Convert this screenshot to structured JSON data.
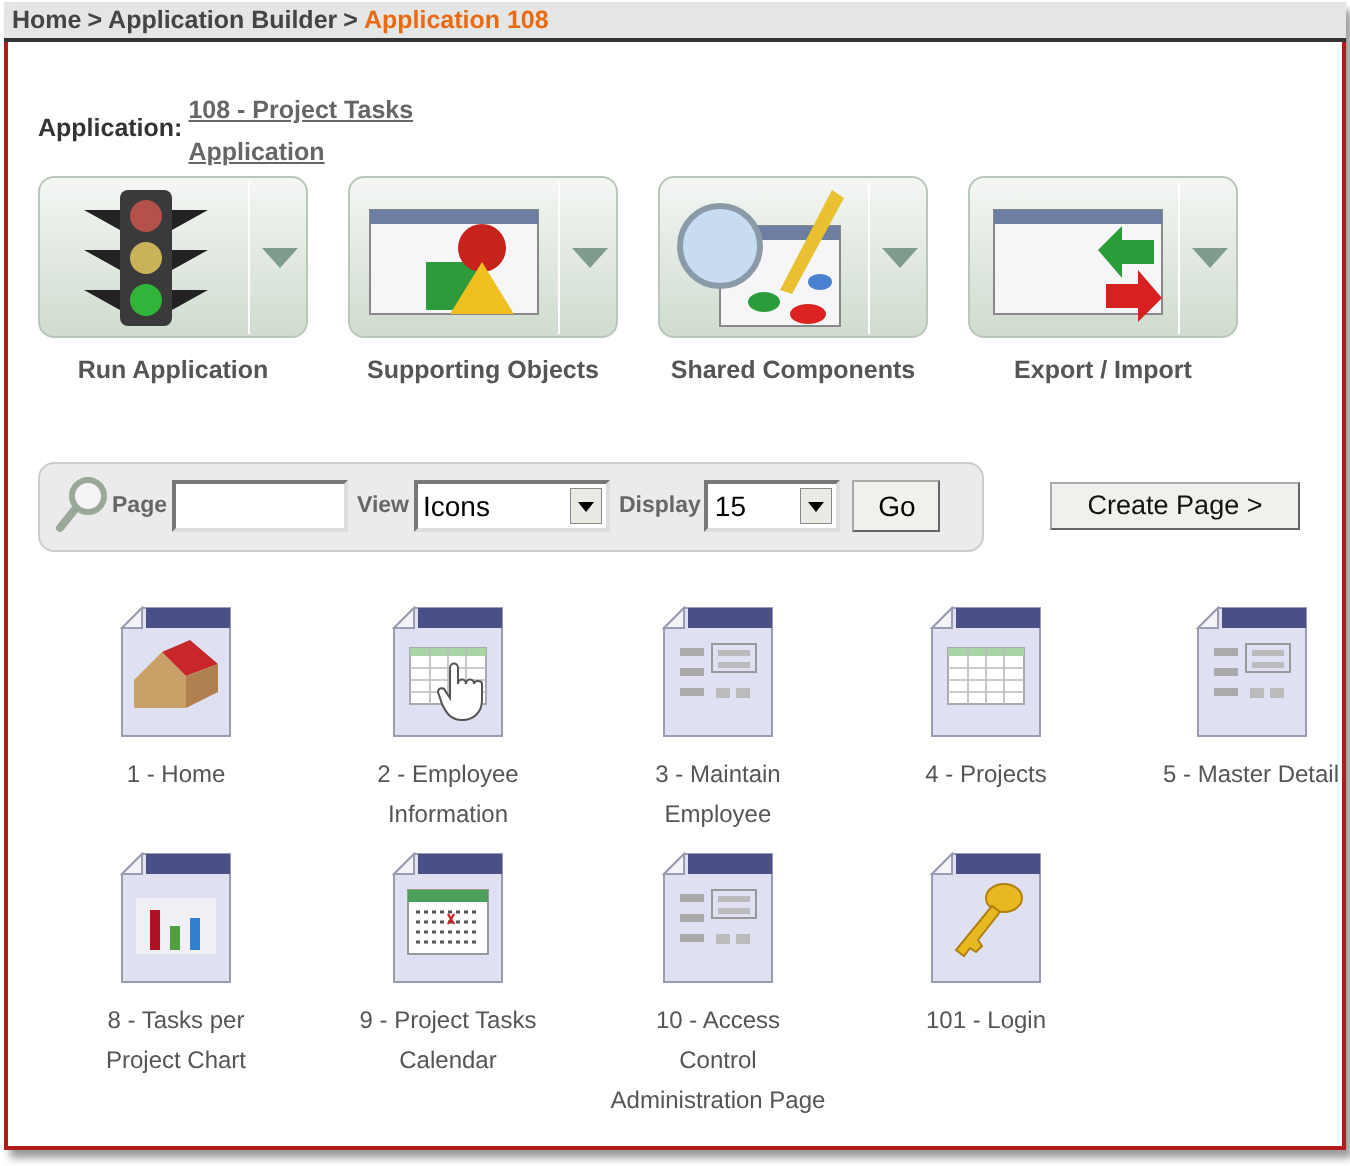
{
  "breadcrumb": [
    {
      "label": "Home",
      "current": false
    },
    {
      "label": "Application Builder",
      "current": false
    },
    {
      "label": "Application 108",
      "current": true
    }
  ],
  "breadcrumb_separator": ">",
  "application": {
    "label": "Application:",
    "link_lines": [
      "108 - Project Tasks",
      "Application"
    ]
  },
  "big_buttons": [
    {
      "label": "Run Application",
      "kind": "traffic"
    },
    {
      "label": "Supporting Objects",
      "kind": "shapes"
    },
    {
      "label": "Shared Components",
      "kind": "compass"
    },
    {
      "label": "Export / Import",
      "kind": "arrows"
    }
  ],
  "search_bar": {
    "page_label": "Page",
    "view_label": "View",
    "view_value": "Icons",
    "display_label": "Display",
    "display_value": "15",
    "go": "Go"
  },
  "create_button": "Create Page >",
  "pages": [
    {
      "lines": [
        "1 - Home"
      ],
      "kind": "home"
    },
    {
      "lines": [
        "2 - Employee",
        "Information"
      ],
      "kind": "grid-hand"
    },
    {
      "lines": [
        "3 - Maintain",
        "Employee"
      ],
      "kind": "form"
    },
    {
      "lines": [
        "4 - Projects"
      ],
      "kind": "grid"
    },
    {
      "lines": [
        "5 - Master Detail"
      ],
      "kind": "form"
    },
    {
      "lines": [
        "8 - Tasks per",
        "Project Chart"
      ],
      "kind": "chart"
    },
    {
      "lines": [
        "9 - Project Tasks",
        "Calendar"
      ],
      "kind": "calendar"
    },
    {
      "lines": [
        "10 - Access",
        "Control",
        "Administration Page"
      ],
      "kind": "form"
    },
    {
      "lines": [
        "101 - Login"
      ],
      "kind": "key"
    }
  ]
}
